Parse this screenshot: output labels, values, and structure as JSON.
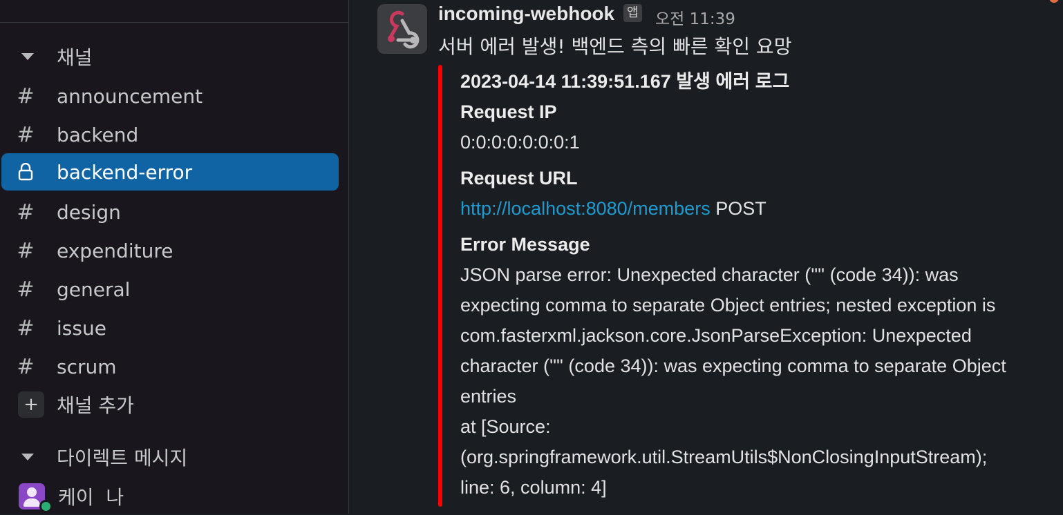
{
  "sidebar": {
    "channels_section": {
      "label": "채널"
    },
    "channels": [
      {
        "name": "announcement",
        "icon": "hash-icon",
        "active": false
      },
      {
        "name": "backend",
        "icon": "hash-icon",
        "active": false
      },
      {
        "name": "backend-error",
        "icon": "lock-icon",
        "active": true
      },
      {
        "name": "design",
        "icon": "hash-icon",
        "active": false
      },
      {
        "name": "expenditure",
        "icon": "hash-icon",
        "active": false
      },
      {
        "name": "general",
        "icon": "hash-icon",
        "active": false
      },
      {
        "name": "issue",
        "icon": "hash-icon",
        "active": false
      },
      {
        "name": "scrum",
        "icon": "hash-icon",
        "active": false
      }
    ],
    "add_channel": {
      "label": "채널 추가",
      "icon": "plus-icon"
    },
    "dm_section": {
      "label": "다이렉트 메시지"
    },
    "dms": [
      {
        "name": "케이  나",
        "icon": "avatar",
        "presence": "online"
      }
    ]
  },
  "message": {
    "author": "incoming-webhook",
    "badge": "앱",
    "time": "오전 11:39",
    "text": "서버 에러 발생! 백엔드 측의 빠른 확인 요망",
    "attachment": {
      "color": "#ff0000",
      "title": "2023-04-14 11:39:51.167 발생 에러 로그",
      "fields": {
        "request_ip_label": "Request IP",
        "request_ip_value": "0:0:0:0:0:0:0:1",
        "request_url_label": "Request URL",
        "request_url_link": "http://localhost:8080/members",
        "request_url_method": "POST",
        "error_message_label": "Error Message",
        "error_message_lines": [
          "JSON parse error: Unexpected character ('\"' (code 34)): was",
          "expecting comma to separate Object entries; nested exception is",
          "com.fasterxml.jackson.core.JsonParseException: Unexpected",
          "character ('\"' (code 34)): was expecting comma to separate Object",
          "entries",
          "at [Source:",
          "(org.springframework.util.StreamUtils$NonClosingInputStream);",
          "line: 6, column: 4]"
        ]
      }
    }
  },
  "colors": {
    "active_channel": "#1164a3",
    "link": "#1d9bd1",
    "presence_online": "#2bac76"
  }
}
